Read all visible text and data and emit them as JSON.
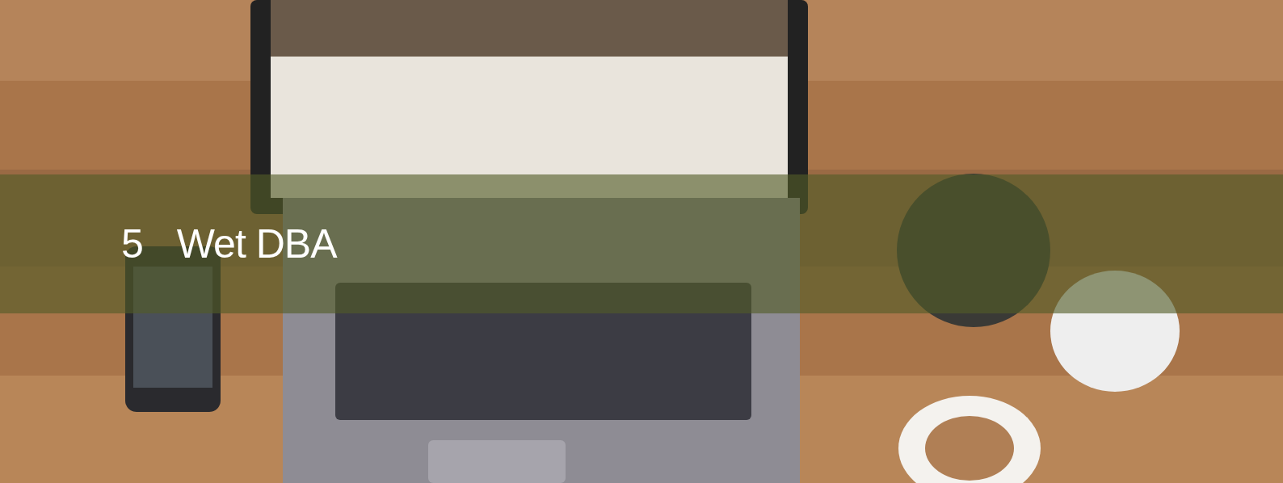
{
  "banner": {
    "number": "5",
    "title": "Wet DBA"
  }
}
